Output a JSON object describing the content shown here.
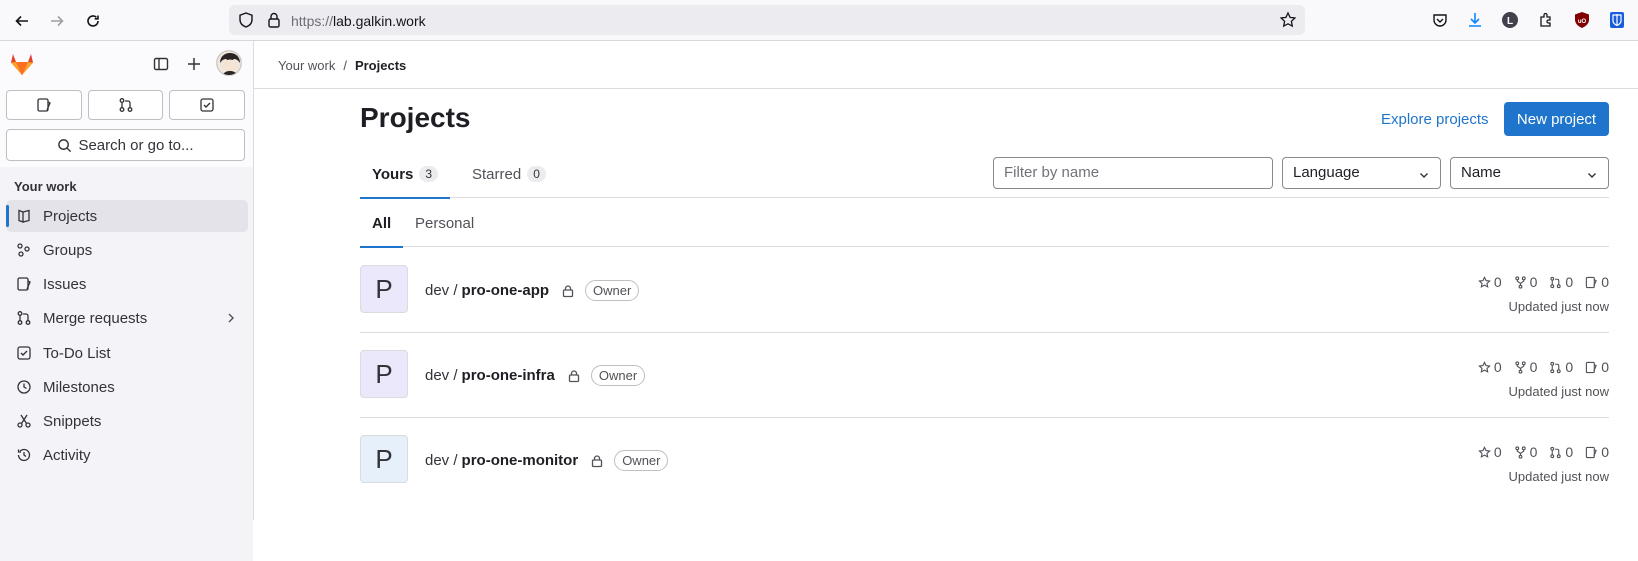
{
  "browser": {
    "url_proto": "https://",
    "url_host": "lab.galkin.work"
  },
  "sidebar": {
    "search_placeholder": "Search or go to...",
    "section_title": "Your work",
    "items": [
      {
        "label": "Projects",
        "icon": "project-icon"
      },
      {
        "label": "Groups",
        "icon": "group-icon"
      },
      {
        "label": "Issues",
        "icon": "issues-icon"
      },
      {
        "label": "Merge requests",
        "icon": "merge-request-icon"
      },
      {
        "label": "To-Do List",
        "icon": "todo-icon"
      },
      {
        "label": "Milestones",
        "icon": "clock-icon"
      },
      {
        "label": "Snippets",
        "icon": "snippet-icon"
      },
      {
        "label": "Activity",
        "icon": "history-icon"
      }
    ]
  },
  "breadcrumb": {
    "parent": "Your work",
    "separator": "/",
    "current": "Projects"
  },
  "main": {
    "title": "Projects",
    "explore_label": "Explore projects",
    "new_project_label": "New project",
    "tabs": [
      {
        "label": "Yours",
        "count": "3"
      },
      {
        "label": "Starred",
        "count": "0"
      }
    ],
    "filter_placeholder": "Filter by name",
    "language_select": "Language",
    "sort_select": "Name",
    "subtabs": [
      "All",
      "Personal"
    ],
    "projects": [
      {
        "initial": "P",
        "namespace": "dev /",
        "name": "pro-one-app",
        "badge": "Owner",
        "stars": "0",
        "forks": "0",
        "mrs": "0",
        "issues": "0",
        "updated": "Updated just now",
        "avatar_bg": "#ece8fb"
      },
      {
        "initial": "P",
        "namespace": "dev /",
        "name": "pro-one-infra",
        "badge": "Owner",
        "stars": "0",
        "forks": "0",
        "mrs": "0",
        "issues": "0",
        "updated": "Updated just now",
        "avatar_bg": "#ece8fb"
      },
      {
        "initial": "P",
        "namespace": "dev /",
        "name": "pro-one-monitor",
        "badge": "Owner",
        "stars": "0",
        "forks": "0",
        "mrs": "0",
        "issues": "0",
        "updated": "Updated just now",
        "avatar_bg": "#e6f0fb"
      }
    ]
  },
  "colors": {
    "accent": "#1f75cb",
    "brand_orange": "#e24329"
  }
}
